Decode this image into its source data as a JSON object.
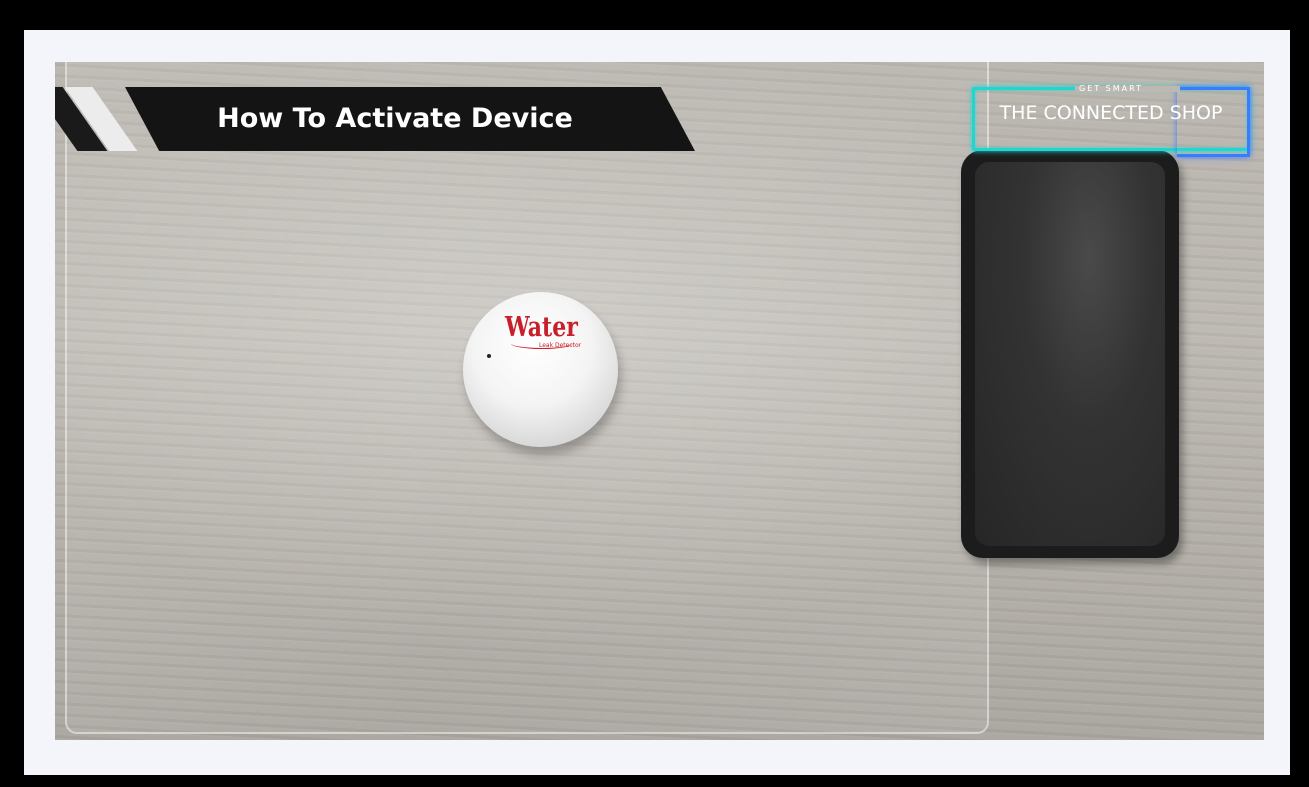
{
  "video": {
    "title": "How To Activate Device",
    "brand": {
      "tagline": "GET SMART",
      "name": "THE CONNECTED SHOP"
    },
    "device_label": "Water",
    "device_sublabel": "Leak Detector"
  },
  "colors": {
    "banner_bg": "#141414",
    "brand_cyan": "#20d6d0",
    "brand_blue": "#3a7bff",
    "logo_red": "#c8202a",
    "frame_bg": "#f3f5fb"
  }
}
